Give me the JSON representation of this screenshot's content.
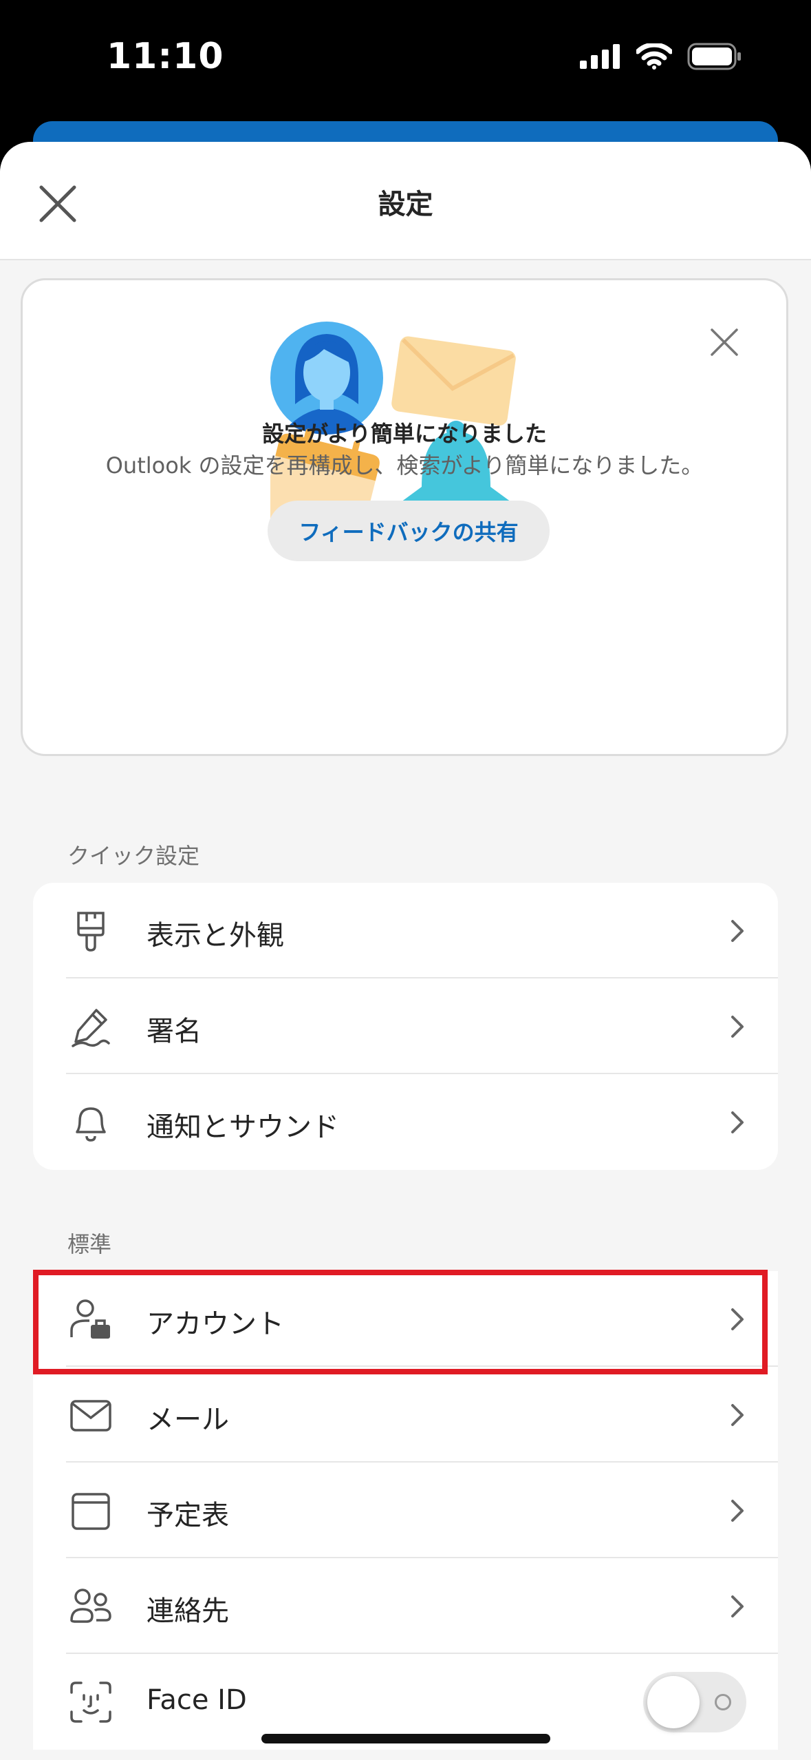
{
  "status": {
    "time": "11:10"
  },
  "header": {
    "title": "設定"
  },
  "banner": {
    "title": "設定がより簡単になりました",
    "description": "Outlook の設定を再構成し、検索がより簡単になりました。",
    "button_label": "フィードバックの共有"
  },
  "quick": {
    "label": "クイック設定",
    "items": [
      {
        "label": "表示と外観",
        "icon": "paintbrush-icon"
      },
      {
        "label": "署名",
        "icon": "signature-icon"
      },
      {
        "label": "通知とサウンド",
        "icon": "bell-icon"
      }
    ]
  },
  "standard": {
    "label": "標準",
    "items": [
      {
        "label": "アカウント",
        "icon": "account-briefcase-icon"
      },
      {
        "label": "メール",
        "icon": "mail-icon"
      },
      {
        "label": "予定表",
        "icon": "calendar-icon"
      },
      {
        "label": "連絡先",
        "icon": "contacts-icon"
      },
      {
        "label": "Face ID",
        "icon": "face-id-icon",
        "toggle": false
      }
    ]
  },
  "colors": {
    "accent": "#0f6cbd",
    "highlight": "#e01b24"
  }
}
